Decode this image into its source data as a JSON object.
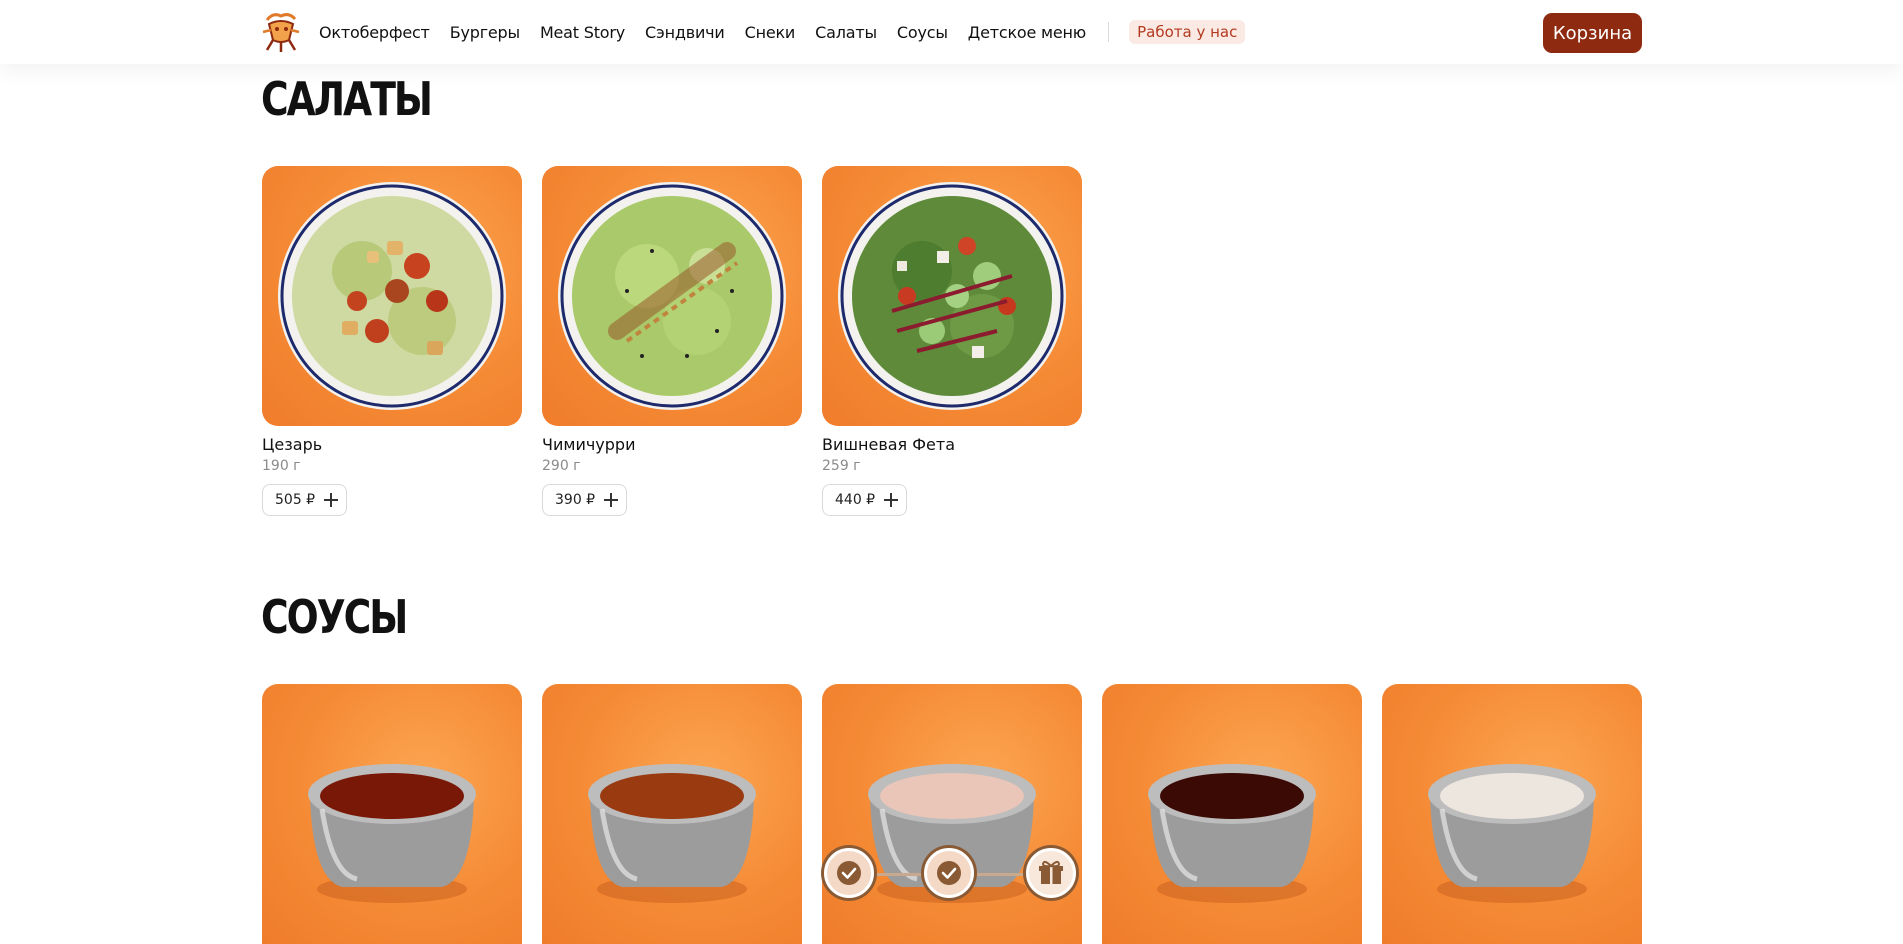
{
  "header": {
    "nav": [
      "Октоберфест",
      "Бургеры",
      "Meat Story",
      "Сэндвичи",
      "Снеки",
      "Салаты",
      "Соусы",
      "Детское меню"
    ],
    "jobs_link": "Работа у нас",
    "cart_label": "Корзина"
  },
  "salads": {
    "title": "САЛАТЫ",
    "items": [
      {
        "name": "Цезарь",
        "weight": "190 г",
        "price": "505 ₽"
      },
      {
        "name": "Чимичурри",
        "weight": "290 г",
        "price": "390 ₽"
      },
      {
        "name": "Вишневая Фета",
        "weight": "259 г",
        "price": "440 ₽"
      }
    ]
  },
  "sauces": {
    "title": "СОУСЫ",
    "items": [
      {
        "sauce_color": "#7a1808"
      },
      {
        "sauce_color": "#9a3a10"
      },
      {
        "sauce_color": "#e9c6b8"
      },
      {
        "sauce_color": "#3b0a04"
      },
      {
        "sauce_color": "#ece6df"
      }
    ]
  },
  "loyalty_progress": {
    "steps": [
      "check-icon",
      "check-icon",
      "gift-icon"
    ],
    "completed": 2,
    "total": 3
  },
  "colors": {
    "accent": "#8e2a10",
    "card_background": "#f58a35",
    "jobs_badge": "#fbe9e3"
  }
}
